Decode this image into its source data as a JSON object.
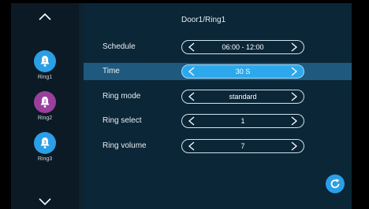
{
  "header": {
    "title": "Door1/Ring1"
  },
  "sidebar": {
    "items": [
      {
        "label": "Ring1",
        "number": "1",
        "color": "#2a9fe6"
      },
      {
        "label": "Ring2",
        "number": "2",
        "color": "#9a3f9e"
      },
      {
        "label": "Ring3",
        "number": "3",
        "color": "#2a9fe6"
      }
    ]
  },
  "settings": [
    {
      "label": "Schedule",
      "value": "06:00 - 12:00"
    },
    {
      "label": "Time",
      "value": "30 S"
    },
    {
      "label": "Ring mode",
      "value": "standard"
    },
    {
      "label": "Ring select",
      "value": "1"
    },
    {
      "label": "Ring volume",
      "value": "7"
    }
  ],
  "icons": {
    "scroll_up": "chevron-up-icon",
    "scroll_down": "chevron-down-icon",
    "bell": "bell-icon",
    "refresh": "refresh-icon"
  },
  "colors": {
    "accent": "#2a9fe6",
    "active_row": "#1f5a7e",
    "panel": "#0b2637",
    "sidebar": "#0b1a24"
  }
}
